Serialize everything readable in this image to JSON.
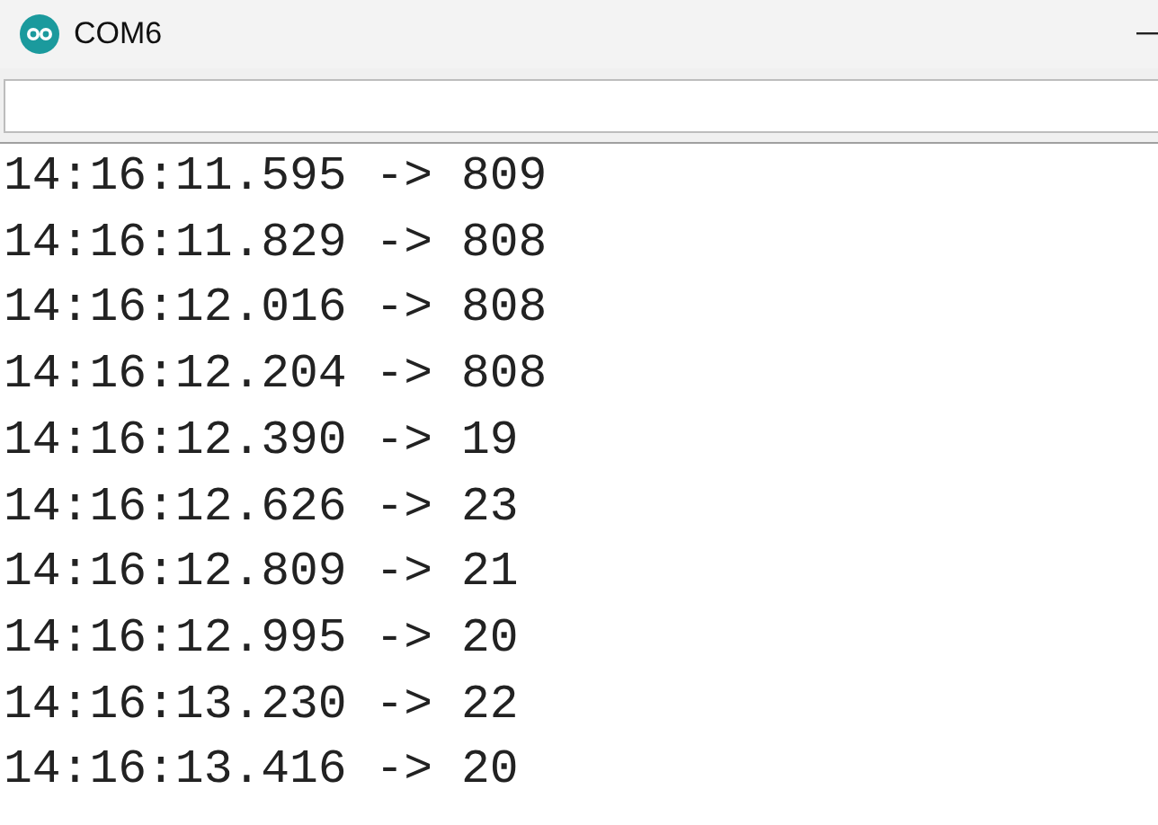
{
  "window": {
    "title": "COM6"
  },
  "output": [
    "14:16:11.595 -> 809",
    "14:16:11.829 -> 808",
    "14:16:12.016 -> 808",
    "14:16:12.204 -> 808",
    "14:16:12.390 -> 19",
    "14:16:12.626 -> 23",
    "14:16:12.809 -> 21",
    "14:16:12.995 -> 20",
    "14:16:13.230 -> 22",
    "14:16:13.416 -> 20"
  ]
}
